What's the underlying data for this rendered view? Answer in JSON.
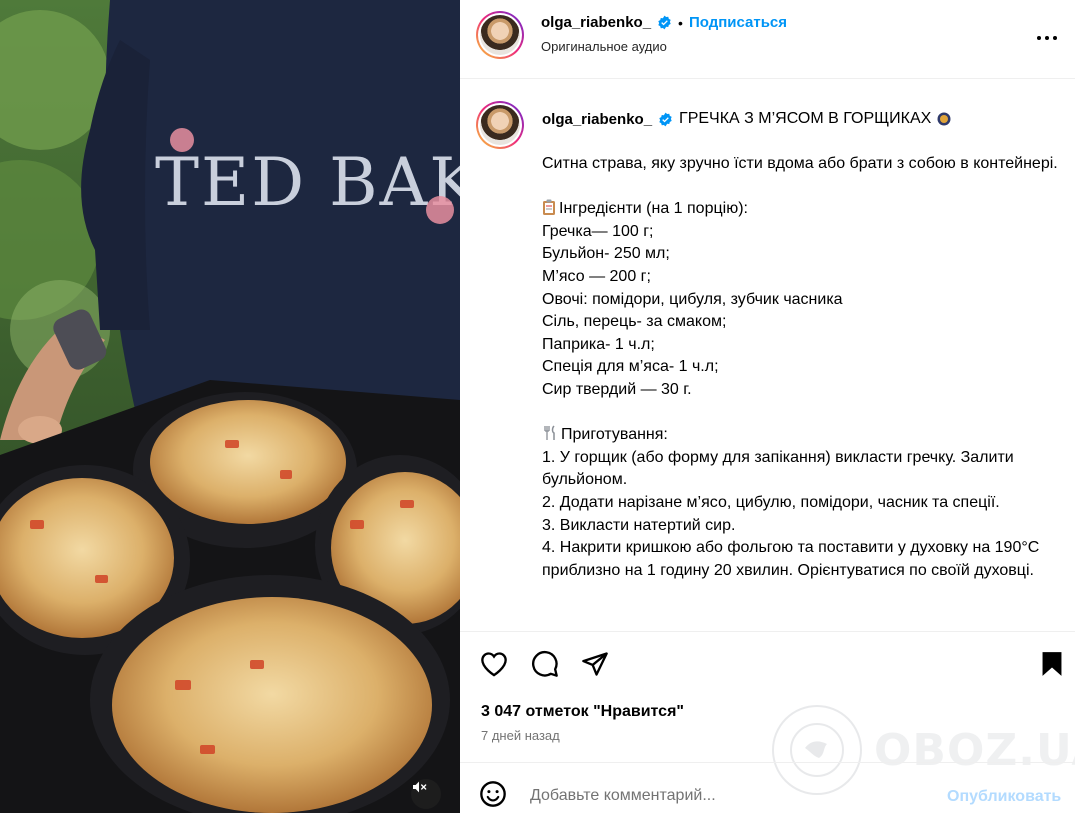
{
  "header": {
    "username": "olga_riabenko_",
    "separator": "•",
    "follow_label": "Подписаться",
    "audio_label": "Оригинальное аудио"
  },
  "caption": {
    "username": "olga_riabenko_",
    "title": "ГРЕЧКА З М’ЯСОМ В ГОРЩИКАХ",
    "intro": "Ситна страва, яку зручно їсти вдома або брати з собою в контейнері.",
    "ingredients_heading": "Інгредієнти (на 1 порцію):",
    "ingredients": [
      "Гречка— 100 г;",
      "Бульйон- 250 мл;",
      "М’ясо — 200 г;",
      "Овочі: помідори, цибуля, зубчик часника",
      "Сіль, перець- за смаком;",
      "Паприка- 1 ч.л;",
      "Спеція для м’яса- 1 ч.л;",
      "Сир твердий — 30 г."
    ],
    "cooking_heading": "Приготування:",
    "steps": [
      "1. У горщик (або форму для запікання) викласти гречку. Залити бульйоном.",
      "2. Додати нарізане м’ясо, цибулю, помідори, часник та спеції.",
      "3. Викласти натертий сир.",
      "4. Накрити кришкою або фольгою та поставити у духовку на 190°C приблизно на 1 годину 20 хвилин. Орієнтуватися по своїй духовці."
    ]
  },
  "stats": {
    "likes": "3 047 отметок \"Нравится\"",
    "time": "7 дней назад"
  },
  "comment": {
    "placeholder": "Добавьте комментарий...",
    "publish_label": "Опубликовать"
  },
  "watermark": {
    "text": "OBOZ.UA"
  },
  "media": {
    "sweater_text": "TED BAKE"
  },
  "icons": {
    "more": "more-horizontal-icon",
    "like": "heart-icon",
    "comment": "comment-bubble-icon",
    "share": "paper-plane-icon",
    "save": "bookmark-icon",
    "emoji": "smiley-icon",
    "mute": "speaker-muted-icon",
    "verified": "verified-badge-icon"
  },
  "colors": {
    "link": "#0095f6",
    "publish_disabled": "#b3dbff",
    "muted_text": "#737373",
    "verified": "#0095f6"
  }
}
